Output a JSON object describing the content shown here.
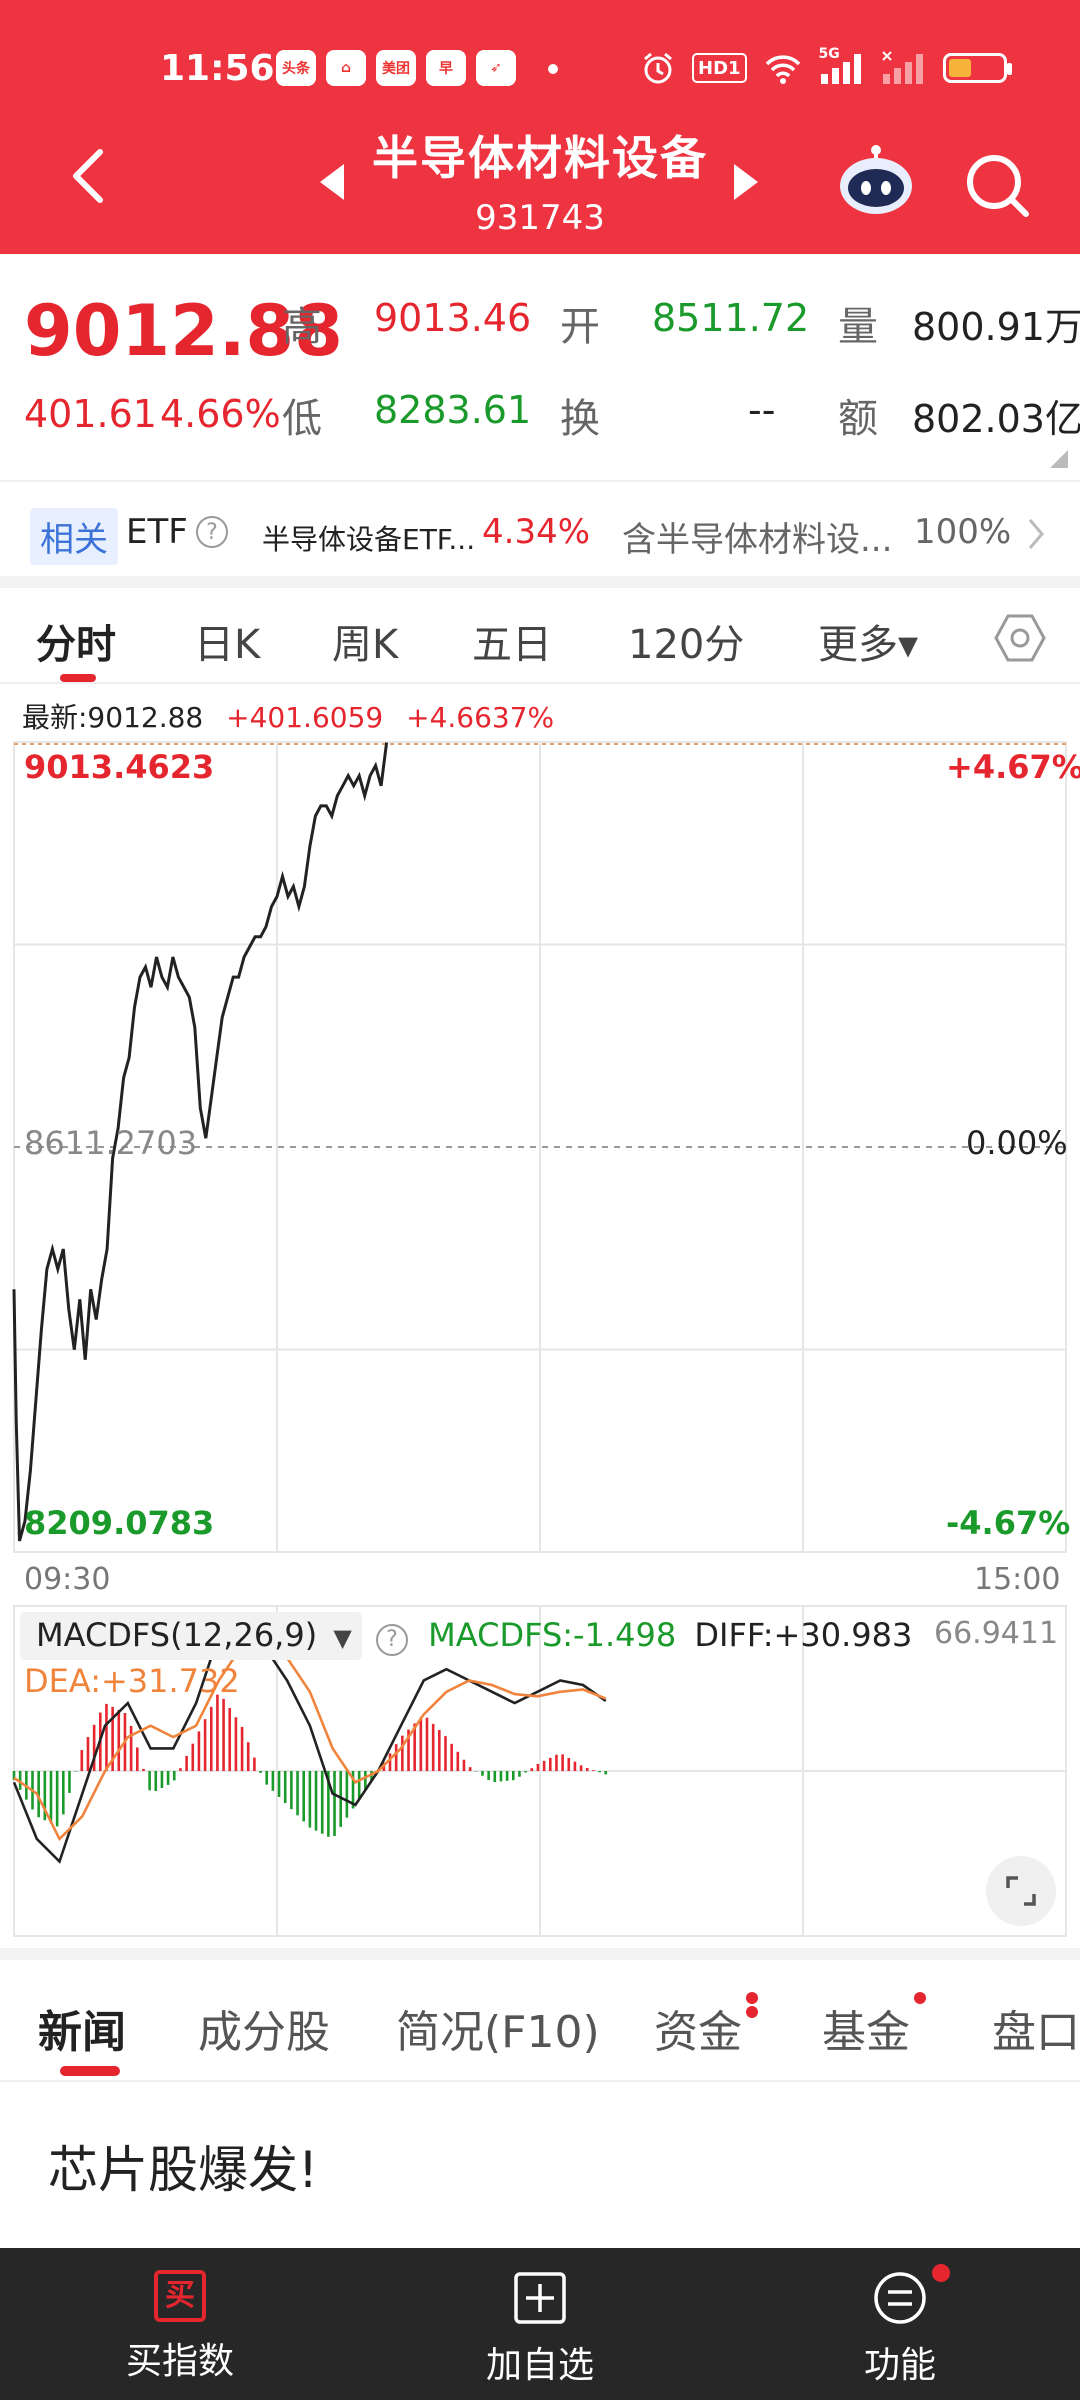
{
  "status_bar": {
    "time": "11:56",
    "apps": [
      "头条",
      "⌂",
      "美团",
      "早",
      "➶"
    ],
    "hd_label": "HD1",
    "net_label": "5G",
    "colors": {
      "header_bg": "#ee3441",
      "battery_fill": "#f7b23b"
    }
  },
  "header": {
    "title": "半导体材料设备",
    "code": "931743"
  },
  "quote": {
    "price": "9012.88",
    "change": "401.61",
    "change_pct": "4.66%",
    "high_label": "高",
    "high": "9013.46",
    "open_label": "开",
    "open": "8511.72",
    "volume_label": "量",
    "volume": "800.91万",
    "low_label": "低",
    "low": "8283.61",
    "turnover_label": "换",
    "turnover": "--",
    "amount_label": "额",
    "amount": "802.03亿"
  },
  "etf_bar": {
    "tag": "相关",
    "label": "ETF",
    "help": "?",
    "fund_name": "半导体设备ETF...",
    "fund_pct": "4.34%",
    "contains": "含半导体材料设...",
    "contains_pct": "100%"
  },
  "chart_tabs": [
    "分时",
    "日K",
    "周K",
    "五日",
    "120分",
    "更多▾"
  ],
  "chart_info": {
    "latest": "最新:9012.88",
    "chg": "+401.6059",
    "pct": "+4.6637%"
  },
  "chart_labels": {
    "top_left": "9013.4623",
    "top_right": "+4.67%",
    "mid_left": "8611.2703",
    "mid_right": "0.00%",
    "bottom_left": "8209.0783",
    "bottom_right": "-4.67%",
    "time_start": "09:30",
    "time_end": "15:00"
  },
  "macd": {
    "selector": "MACDFS(12,26,9)",
    "help": "?",
    "macdfs": "MACDFS:-1.498",
    "diff": "DIFF:+30.983",
    "dea": "DEA:+31.732",
    "max": "66.9411"
  },
  "news_tabs": [
    "新闻",
    "成分股",
    "简况(F10)",
    "资金",
    "基金",
    "盘口"
  ],
  "news": {
    "headline": "芯片股爆发!"
  },
  "bottom_bar": {
    "buy": "买指数",
    "buy_icon": "买",
    "add": "加自选",
    "func": "功能"
  },
  "chart_data": {
    "type": "line",
    "title": "",
    "xlabel": "",
    "ylabel": "",
    "x_range": [
      "09:30",
      "15:00"
    ],
    "ylim": [
      8209.0783,
      9013.4623
    ],
    "reference": 8611.2703,
    "x": [
      0,
      2,
      5,
      10,
      15,
      20,
      25,
      30,
      35,
      40,
      45,
      50,
      55,
      60,
      65,
      70,
      75,
      80,
      85,
      90,
      95,
      100,
      105,
      110,
      115,
      120,
      125,
      130,
      135,
      140,
      145,
      150,
      155,
      160,
      165,
      170,
      175,
      180,
      185,
      190,
      195,
      200,
      205,
      210,
      215,
      220,
      225,
      230,
      235,
      240,
      245,
      250,
      255,
      260,
      265,
      270,
      275,
      280,
      285,
      290,
      295,
      300,
      305,
      310,
      315,
      320,
      325,
      330,
      335,
      340,
      345,
      350,
      355,
      360,
      365,
      370,
      375,
      380,
      385,
      390,
      395,
      400,
      405,
      410,
      415,
      420,
      425,
      430,
      435,
      440,
      445,
      450,
      455,
      460,
      465,
      470,
      475,
      480,
      485,
      490,
      495,
      500,
      505,
      510,
      515,
      520,
      525,
      530,
      535,
      540
    ],
    "y": [
      8470,
      8340,
      8220,
      8240,
      8290,
      8360,
      8430,
      8490,
      8510,
      8490,
      8510,
      8450,
      8410,
      8460,
      8400,
      8470,
      8440,
      8480,
      8510,
      8600,
      8630,
      8680,
      8700,
      8750,
      8780,
      8790,
      8770,
      8800,
      8780,
      8770,
      8800,
      8780,
      8770,
      8760,
      8730,
      8650,
      8620,
      8660,
      8700,
      8740,
      8760,
      8780,
      8780,
      8800,
      8810,
      8820,
      8820,
      8830,
      8850,
      8860,
      8880,
      8860,
      8870,
      8850,
      8870,
      8910,
      8940,
      8950,
      8950,
      8940,
      8960,
      8970,
      8980,
      8970,
      8980,
      8960,
      8980,
      8990,
      8970,
      9012.88
    ],
    "series_macd": {
      "diff": [
        -5,
        -30,
        -40,
        -10,
        20,
        30,
        10,
        10,
        30,
        60,
        66,
        55,
        40,
        20,
        -10,
        -15,
        0,
        20,
        40,
        45,
        40,
        35,
        30,
        35,
        40,
        38,
        31
      ],
      "dea": [
        -3,
        -10,
        -30,
        -20,
        0,
        15,
        20,
        15,
        20,
        40,
        55,
        58,
        50,
        35,
        10,
        -5,
        0,
        10,
        25,
        35,
        40,
        38,
        34,
        33,
        35,
        36,
        32
      ],
      "macdfs": [
        -4,
        -20,
        -25,
        10,
        30,
        25,
        -10,
        -5,
        15,
        35,
        20,
        -5,
        -15,
        -25,
        -30,
        -15,
        0,
        15,
        25,
        15,
        2,
        -5,
        -4,
        3,
        8,
        2,
        -1.5
      ]
    }
  }
}
